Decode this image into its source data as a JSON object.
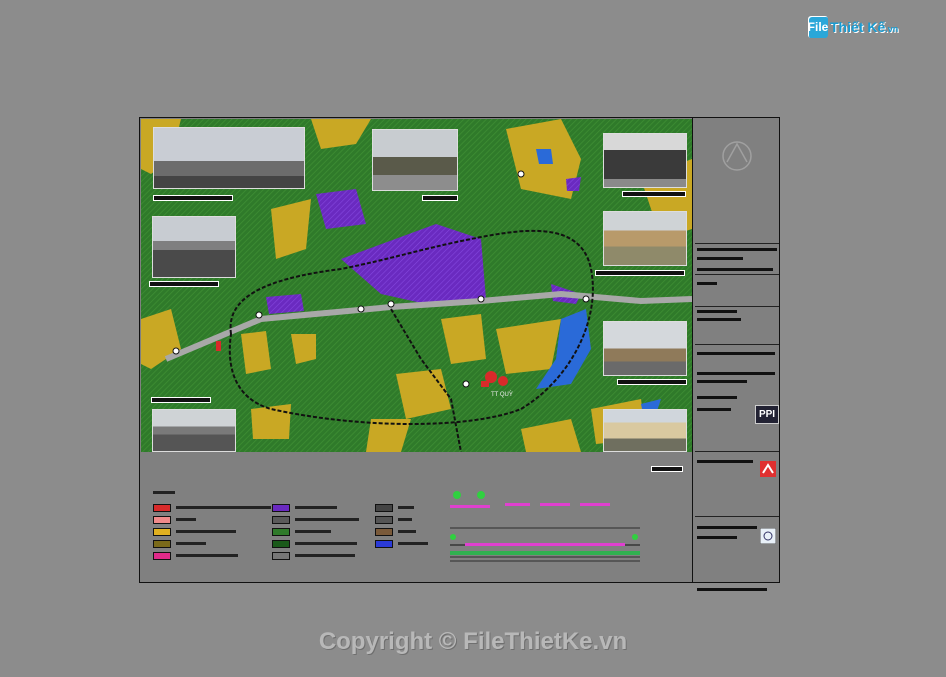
{
  "logo": {
    "badge": "File",
    "name": "Thiết Kế",
    "suffix": ".vn"
  },
  "title_block": {
    "company_logo": "PPI"
  },
  "watermark": {
    "text": "Copyright © FileThietKe.vn"
  },
  "colors": {
    "background": "#8c8c8c",
    "map_green": "#2f7a2a",
    "residential_yellow": "#e0b020",
    "industrial_purple": "#6a2ac0",
    "road_grey": "#a8a8a8",
    "water_blue": "#2a6ad8",
    "brand_blue": "#1b9bd1"
  },
  "map": {
    "label_town": "TT QUỲ"
  }
}
